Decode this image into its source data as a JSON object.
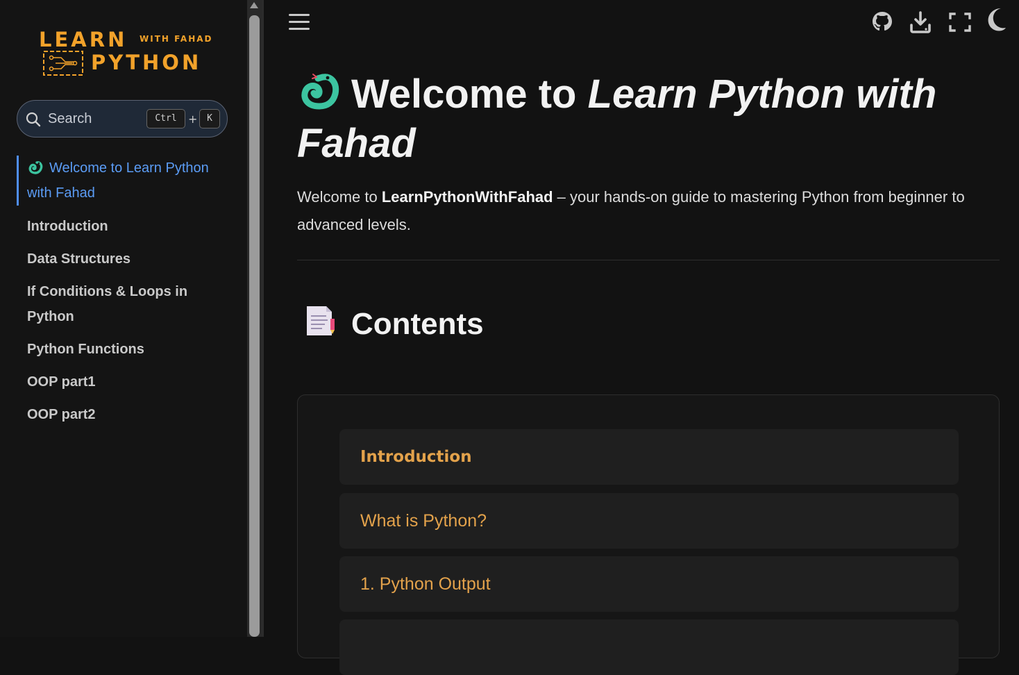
{
  "logo": {
    "learn": "LEARN",
    "with": "WITH FAHAD",
    "python": "PYTHON"
  },
  "search": {
    "placeholder": "Search",
    "shortcut_ctrl": "Ctrl",
    "shortcut_plus": "+",
    "shortcut_key": "K"
  },
  "sidebar": {
    "items": [
      {
        "label": "Welcome to Learn Python with Fahad",
        "active": true
      },
      {
        "label": "Introduction"
      },
      {
        "label": "Data Structures"
      },
      {
        "label": "If Conditions & Loops in Python"
      },
      {
        "label": "Python Functions"
      },
      {
        "label": "OOP part1"
      },
      {
        "label": "OOP part2"
      }
    ]
  },
  "toolbar": {
    "icons": [
      "menu-icon",
      "github-icon",
      "download-icon",
      "fullscreen-icon",
      "dark-mode-icon"
    ]
  },
  "main": {
    "title_plain": "Welcome to ",
    "title_em": "Learn Python with Fahad",
    "intro_start": "Welcome to ",
    "intro_bold": "LearnPythonWithFahad",
    "intro_end": " – your hands-on guide to mastering Python from beginner to advanced levels.",
    "contents_heading": "Contents",
    "toc": [
      "Introduction",
      "What is Python?",
      "1. Python Output"
    ]
  },
  "colors": {
    "accent": "#e3a24b",
    "active_link": "#5b9cf5",
    "background": "#121212"
  }
}
